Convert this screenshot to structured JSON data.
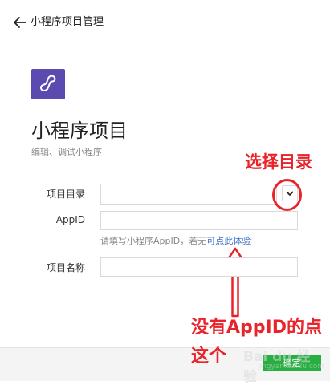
{
  "header": {
    "title": "小程序项目管理",
    "back_icon": "arrow-left-icon"
  },
  "logo": {
    "icon": "mini-program-logo-icon",
    "color": "#5b4ab0"
  },
  "page": {
    "title": "小程序项目",
    "subtitle": "编辑、调试小程序"
  },
  "form": {
    "project_dir": {
      "label": "项目目录",
      "value": "",
      "dropdown_icon": "chevron-down-icon"
    },
    "appid": {
      "label": "AppID",
      "value": "",
      "hint_text": "请填写小程序AppID，若无",
      "hint_link": "可点此体验"
    },
    "project_name": {
      "label": "项目名称",
      "value": ""
    }
  },
  "footer": {
    "confirm_label": "确定"
  },
  "annotations": {
    "select_dir": "选择目录",
    "no_appid_line1": "没有AppID的点",
    "no_appid_line2": "这个",
    "color": "#e8232a"
  },
  "watermark": {
    "logo": "Bai du 经验",
    "url": "jingyan.baidu.com"
  }
}
